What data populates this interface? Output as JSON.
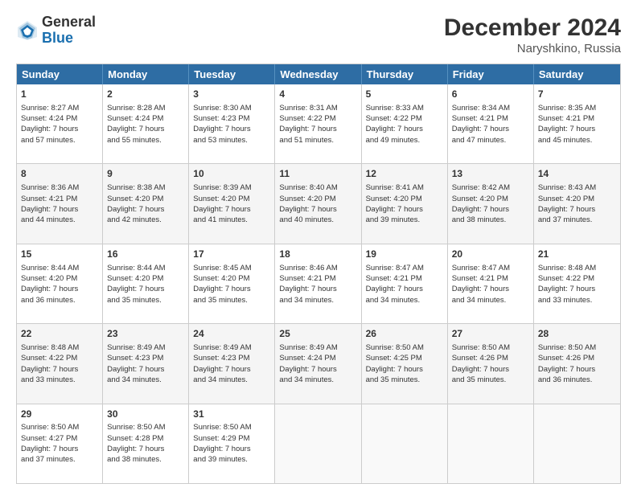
{
  "header": {
    "logo_general": "General",
    "logo_blue": "Blue",
    "main_title": "December 2024",
    "sub_title": "Naryshkino, Russia"
  },
  "weekdays": [
    "Sunday",
    "Monday",
    "Tuesday",
    "Wednesday",
    "Thursday",
    "Friday",
    "Saturday"
  ],
  "rows": [
    [
      {
        "day": "1",
        "line1": "Sunrise: 8:27 AM",
        "line2": "Sunset: 4:24 PM",
        "line3": "Daylight: 7 hours",
        "line4": "and 57 minutes."
      },
      {
        "day": "2",
        "line1": "Sunrise: 8:28 AM",
        "line2": "Sunset: 4:24 PM",
        "line3": "Daylight: 7 hours",
        "line4": "and 55 minutes."
      },
      {
        "day": "3",
        "line1": "Sunrise: 8:30 AM",
        "line2": "Sunset: 4:23 PM",
        "line3": "Daylight: 7 hours",
        "line4": "and 53 minutes."
      },
      {
        "day": "4",
        "line1": "Sunrise: 8:31 AM",
        "line2": "Sunset: 4:22 PM",
        "line3": "Daylight: 7 hours",
        "line4": "and 51 minutes."
      },
      {
        "day": "5",
        "line1": "Sunrise: 8:33 AM",
        "line2": "Sunset: 4:22 PM",
        "line3": "Daylight: 7 hours",
        "line4": "and 49 minutes."
      },
      {
        "day": "6",
        "line1": "Sunrise: 8:34 AM",
        "line2": "Sunset: 4:21 PM",
        "line3": "Daylight: 7 hours",
        "line4": "and 47 minutes."
      },
      {
        "day": "7",
        "line1": "Sunrise: 8:35 AM",
        "line2": "Sunset: 4:21 PM",
        "line3": "Daylight: 7 hours",
        "line4": "and 45 minutes."
      }
    ],
    [
      {
        "day": "8",
        "line1": "Sunrise: 8:36 AM",
        "line2": "Sunset: 4:21 PM",
        "line3": "Daylight: 7 hours",
        "line4": "and 44 minutes."
      },
      {
        "day": "9",
        "line1": "Sunrise: 8:38 AM",
        "line2": "Sunset: 4:20 PM",
        "line3": "Daylight: 7 hours",
        "line4": "and 42 minutes."
      },
      {
        "day": "10",
        "line1": "Sunrise: 8:39 AM",
        "line2": "Sunset: 4:20 PM",
        "line3": "Daylight: 7 hours",
        "line4": "and 41 minutes."
      },
      {
        "day": "11",
        "line1": "Sunrise: 8:40 AM",
        "line2": "Sunset: 4:20 PM",
        "line3": "Daylight: 7 hours",
        "line4": "and 40 minutes."
      },
      {
        "day": "12",
        "line1": "Sunrise: 8:41 AM",
        "line2": "Sunset: 4:20 PM",
        "line3": "Daylight: 7 hours",
        "line4": "and 39 minutes."
      },
      {
        "day": "13",
        "line1": "Sunrise: 8:42 AM",
        "line2": "Sunset: 4:20 PM",
        "line3": "Daylight: 7 hours",
        "line4": "and 38 minutes."
      },
      {
        "day": "14",
        "line1": "Sunrise: 8:43 AM",
        "line2": "Sunset: 4:20 PM",
        "line3": "Daylight: 7 hours",
        "line4": "and 37 minutes."
      }
    ],
    [
      {
        "day": "15",
        "line1": "Sunrise: 8:44 AM",
        "line2": "Sunset: 4:20 PM",
        "line3": "Daylight: 7 hours",
        "line4": "and 36 minutes."
      },
      {
        "day": "16",
        "line1": "Sunrise: 8:44 AM",
        "line2": "Sunset: 4:20 PM",
        "line3": "Daylight: 7 hours",
        "line4": "and 35 minutes."
      },
      {
        "day": "17",
        "line1": "Sunrise: 8:45 AM",
        "line2": "Sunset: 4:20 PM",
        "line3": "Daylight: 7 hours",
        "line4": "and 35 minutes."
      },
      {
        "day": "18",
        "line1": "Sunrise: 8:46 AM",
        "line2": "Sunset: 4:21 PM",
        "line3": "Daylight: 7 hours",
        "line4": "and 34 minutes."
      },
      {
        "day": "19",
        "line1": "Sunrise: 8:47 AM",
        "line2": "Sunset: 4:21 PM",
        "line3": "Daylight: 7 hours",
        "line4": "and 34 minutes."
      },
      {
        "day": "20",
        "line1": "Sunrise: 8:47 AM",
        "line2": "Sunset: 4:21 PM",
        "line3": "Daylight: 7 hours",
        "line4": "and 34 minutes."
      },
      {
        "day": "21",
        "line1": "Sunrise: 8:48 AM",
        "line2": "Sunset: 4:22 PM",
        "line3": "Daylight: 7 hours",
        "line4": "and 33 minutes."
      }
    ],
    [
      {
        "day": "22",
        "line1": "Sunrise: 8:48 AM",
        "line2": "Sunset: 4:22 PM",
        "line3": "Daylight: 7 hours",
        "line4": "and 33 minutes."
      },
      {
        "day": "23",
        "line1": "Sunrise: 8:49 AM",
        "line2": "Sunset: 4:23 PM",
        "line3": "Daylight: 7 hours",
        "line4": "and 34 minutes."
      },
      {
        "day": "24",
        "line1": "Sunrise: 8:49 AM",
        "line2": "Sunset: 4:23 PM",
        "line3": "Daylight: 7 hours",
        "line4": "and 34 minutes."
      },
      {
        "day": "25",
        "line1": "Sunrise: 8:49 AM",
        "line2": "Sunset: 4:24 PM",
        "line3": "Daylight: 7 hours",
        "line4": "and 34 minutes."
      },
      {
        "day": "26",
        "line1": "Sunrise: 8:50 AM",
        "line2": "Sunset: 4:25 PM",
        "line3": "Daylight: 7 hours",
        "line4": "and 35 minutes."
      },
      {
        "day": "27",
        "line1": "Sunrise: 8:50 AM",
        "line2": "Sunset: 4:26 PM",
        "line3": "Daylight: 7 hours",
        "line4": "and 35 minutes."
      },
      {
        "day": "28",
        "line1": "Sunrise: 8:50 AM",
        "line2": "Sunset: 4:26 PM",
        "line3": "Daylight: 7 hours",
        "line4": "and 36 minutes."
      }
    ],
    [
      {
        "day": "29",
        "line1": "Sunrise: 8:50 AM",
        "line2": "Sunset: 4:27 PM",
        "line3": "Daylight: 7 hours",
        "line4": "and 37 minutes."
      },
      {
        "day": "30",
        "line1": "Sunrise: 8:50 AM",
        "line2": "Sunset: 4:28 PM",
        "line3": "Daylight: 7 hours",
        "line4": "and 38 minutes."
      },
      {
        "day": "31",
        "line1": "Sunrise: 8:50 AM",
        "line2": "Sunset: 4:29 PM",
        "line3": "Daylight: 7 hours",
        "line4": "and 39 minutes."
      },
      null,
      null,
      null,
      null
    ]
  ]
}
